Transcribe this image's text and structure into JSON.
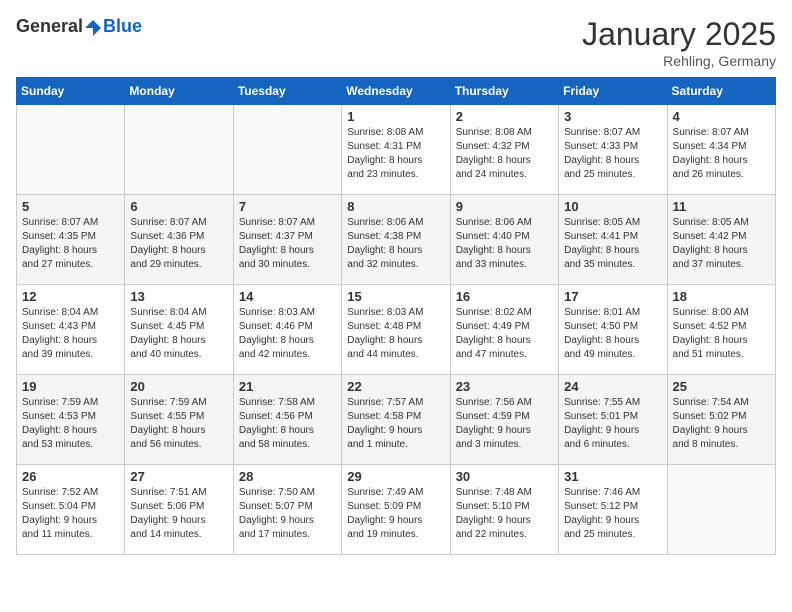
{
  "header": {
    "logo_general": "General",
    "logo_blue": "Blue",
    "title": "January 2025",
    "subtitle": "Rehling, Germany"
  },
  "weekdays": [
    "Sunday",
    "Monday",
    "Tuesday",
    "Wednesday",
    "Thursday",
    "Friday",
    "Saturday"
  ],
  "weeks": [
    [
      {
        "day": "",
        "content": ""
      },
      {
        "day": "",
        "content": ""
      },
      {
        "day": "",
        "content": ""
      },
      {
        "day": "1",
        "content": "Sunrise: 8:08 AM\nSunset: 4:31 PM\nDaylight: 8 hours\nand 23 minutes."
      },
      {
        "day": "2",
        "content": "Sunrise: 8:08 AM\nSunset: 4:32 PM\nDaylight: 8 hours\nand 24 minutes."
      },
      {
        "day": "3",
        "content": "Sunrise: 8:07 AM\nSunset: 4:33 PM\nDaylight: 8 hours\nand 25 minutes."
      },
      {
        "day": "4",
        "content": "Sunrise: 8:07 AM\nSunset: 4:34 PM\nDaylight: 8 hours\nand 26 minutes."
      }
    ],
    [
      {
        "day": "5",
        "content": "Sunrise: 8:07 AM\nSunset: 4:35 PM\nDaylight: 8 hours\nand 27 minutes."
      },
      {
        "day": "6",
        "content": "Sunrise: 8:07 AM\nSunset: 4:36 PM\nDaylight: 8 hours\nand 29 minutes."
      },
      {
        "day": "7",
        "content": "Sunrise: 8:07 AM\nSunset: 4:37 PM\nDaylight: 8 hours\nand 30 minutes."
      },
      {
        "day": "8",
        "content": "Sunrise: 8:06 AM\nSunset: 4:38 PM\nDaylight: 8 hours\nand 32 minutes."
      },
      {
        "day": "9",
        "content": "Sunrise: 8:06 AM\nSunset: 4:40 PM\nDaylight: 8 hours\nand 33 minutes."
      },
      {
        "day": "10",
        "content": "Sunrise: 8:05 AM\nSunset: 4:41 PM\nDaylight: 8 hours\nand 35 minutes."
      },
      {
        "day": "11",
        "content": "Sunrise: 8:05 AM\nSunset: 4:42 PM\nDaylight: 8 hours\nand 37 minutes."
      }
    ],
    [
      {
        "day": "12",
        "content": "Sunrise: 8:04 AM\nSunset: 4:43 PM\nDaylight: 8 hours\nand 39 minutes."
      },
      {
        "day": "13",
        "content": "Sunrise: 8:04 AM\nSunset: 4:45 PM\nDaylight: 8 hours\nand 40 minutes."
      },
      {
        "day": "14",
        "content": "Sunrise: 8:03 AM\nSunset: 4:46 PM\nDaylight: 8 hours\nand 42 minutes."
      },
      {
        "day": "15",
        "content": "Sunrise: 8:03 AM\nSunset: 4:48 PM\nDaylight: 8 hours\nand 44 minutes."
      },
      {
        "day": "16",
        "content": "Sunrise: 8:02 AM\nSunset: 4:49 PM\nDaylight: 8 hours\nand 47 minutes."
      },
      {
        "day": "17",
        "content": "Sunrise: 8:01 AM\nSunset: 4:50 PM\nDaylight: 8 hours\nand 49 minutes."
      },
      {
        "day": "18",
        "content": "Sunrise: 8:00 AM\nSunset: 4:52 PM\nDaylight: 8 hours\nand 51 minutes."
      }
    ],
    [
      {
        "day": "19",
        "content": "Sunrise: 7:59 AM\nSunset: 4:53 PM\nDaylight: 8 hours\nand 53 minutes."
      },
      {
        "day": "20",
        "content": "Sunrise: 7:59 AM\nSunset: 4:55 PM\nDaylight: 8 hours\nand 56 minutes."
      },
      {
        "day": "21",
        "content": "Sunrise: 7:58 AM\nSunset: 4:56 PM\nDaylight: 8 hours\nand 58 minutes."
      },
      {
        "day": "22",
        "content": "Sunrise: 7:57 AM\nSunset: 4:58 PM\nDaylight: 9 hours\nand 1 minute."
      },
      {
        "day": "23",
        "content": "Sunrise: 7:56 AM\nSunset: 4:59 PM\nDaylight: 9 hours\nand 3 minutes."
      },
      {
        "day": "24",
        "content": "Sunrise: 7:55 AM\nSunset: 5:01 PM\nDaylight: 9 hours\nand 6 minutes."
      },
      {
        "day": "25",
        "content": "Sunrise: 7:54 AM\nSunset: 5:02 PM\nDaylight: 9 hours\nand 8 minutes."
      }
    ],
    [
      {
        "day": "26",
        "content": "Sunrise: 7:52 AM\nSunset: 5:04 PM\nDaylight: 9 hours\nand 11 minutes."
      },
      {
        "day": "27",
        "content": "Sunrise: 7:51 AM\nSunset: 5:06 PM\nDaylight: 9 hours\nand 14 minutes."
      },
      {
        "day": "28",
        "content": "Sunrise: 7:50 AM\nSunset: 5:07 PM\nDaylight: 9 hours\nand 17 minutes."
      },
      {
        "day": "29",
        "content": "Sunrise: 7:49 AM\nSunset: 5:09 PM\nDaylight: 9 hours\nand 19 minutes."
      },
      {
        "day": "30",
        "content": "Sunrise: 7:48 AM\nSunset: 5:10 PM\nDaylight: 9 hours\nand 22 minutes."
      },
      {
        "day": "31",
        "content": "Sunrise: 7:46 AM\nSunset: 5:12 PM\nDaylight: 9 hours\nand 25 minutes."
      },
      {
        "day": "",
        "content": ""
      }
    ]
  ]
}
